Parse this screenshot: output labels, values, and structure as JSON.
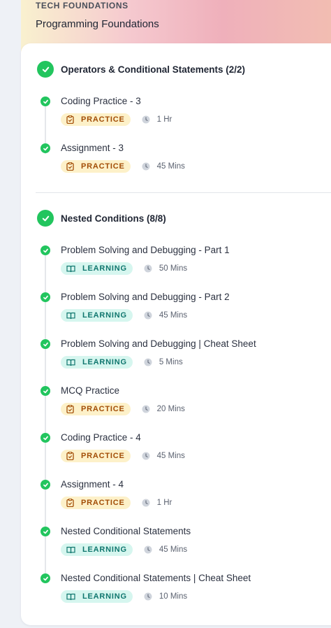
{
  "header": {
    "overline": "TECH FOUNDATIONS",
    "course_title": "Programming Foundations"
  },
  "colors": {
    "complete_green": "#22c55e",
    "practice_bg": "#fdf1c9",
    "practice_text": "#a24d06",
    "learning_bg": "#d6f6ef",
    "learning_text": "#0f766e"
  },
  "sections": [
    {
      "title": "Operators & Conditional Statements (2/2)",
      "items": [
        {
          "title": "Coding Practice - 3",
          "type": "PRACTICE",
          "icon": "clipboard-check-icon",
          "duration": "1 Hr"
        },
        {
          "title": "Assignment - 3",
          "type": "PRACTICE",
          "icon": "clipboard-check-icon",
          "duration": "45 Mins"
        }
      ]
    },
    {
      "title": "Nested Conditions (8/8)",
      "items": [
        {
          "title": "Problem Solving and Debugging - Part 1",
          "type": "LEARNING",
          "icon": "book-open-icon",
          "duration": "50 Mins"
        },
        {
          "title": "Problem Solving and Debugging - Part 2",
          "type": "LEARNING",
          "icon": "book-open-icon",
          "duration": "45 Mins"
        },
        {
          "title": "Problem Solving and Debugging | Cheat Sheet",
          "type": "LEARNING",
          "icon": "book-open-icon",
          "duration": "5 Mins"
        },
        {
          "title": "MCQ Practice",
          "type": "PRACTICE",
          "icon": "clipboard-check-icon",
          "duration": "20 Mins"
        },
        {
          "title": "Coding Practice - 4",
          "type": "PRACTICE",
          "icon": "clipboard-check-icon",
          "duration": "45 Mins"
        },
        {
          "title": "Assignment - 4",
          "type": "PRACTICE",
          "icon": "clipboard-check-icon",
          "duration": "1 Hr"
        },
        {
          "title": "Nested Conditional Statements",
          "type": "LEARNING",
          "icon": "book-open-icon",
          "duration": "45 Mins"
        },
        {
          "title": "Nested Conditional Statements | Cheat Sheet",
          "type": "LEARNING",
          "icon": "book-open-icon",
          "duration": "10 Mins"
        }
      ]
    }
  ]
}
